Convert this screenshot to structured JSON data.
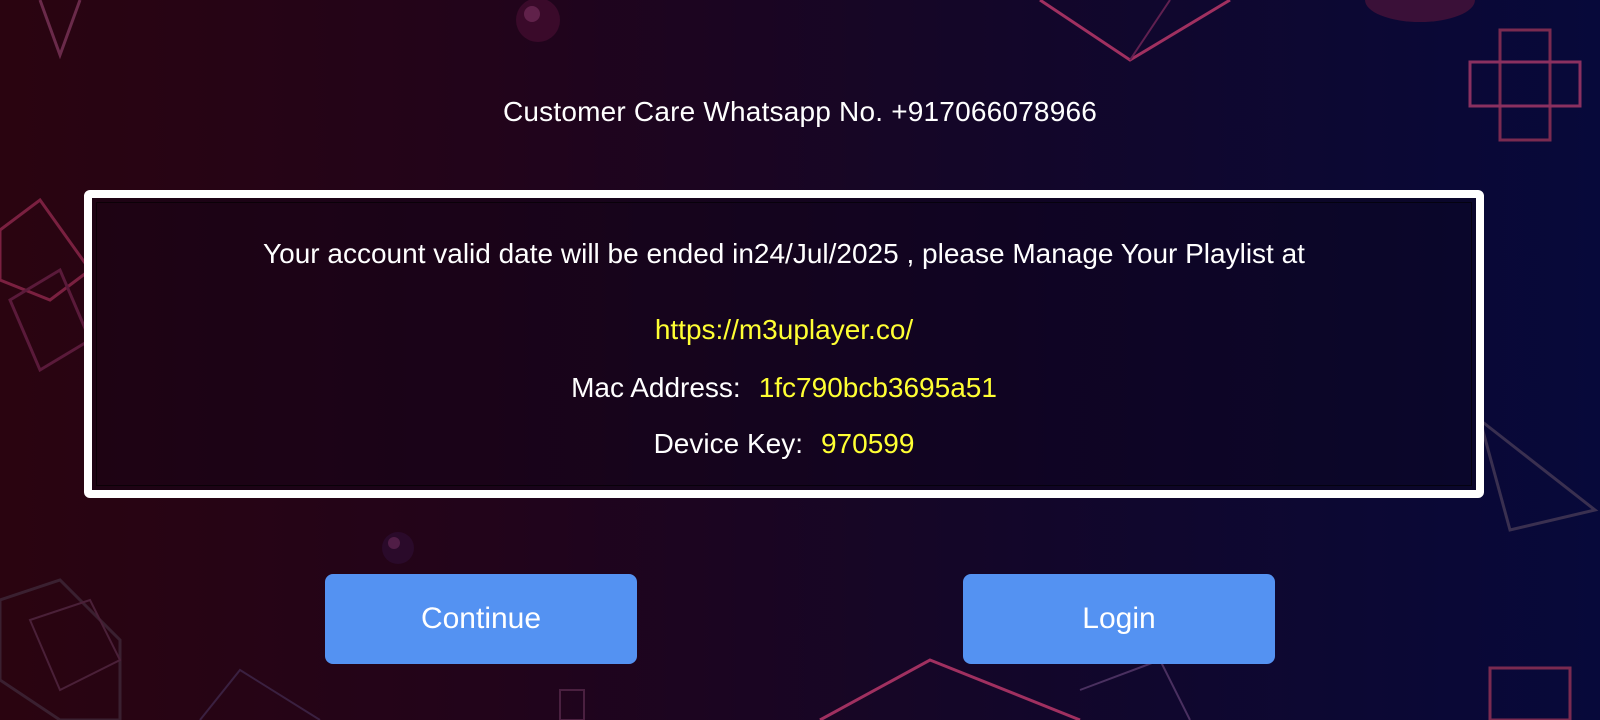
{
  "header": {
    "customer_care": "Customer Care Whatsapp No. +917066078966"
  },
  "account_box": {
    "expiry_message": "Your account valid date will be ended in24/Jul/2025 , please Manage Your Playlist at",
    "url": "https://m3uplayer.co/",
    "mac_label": "Mac Address:",
    "mac_value": "1fc790bcb3695a51",
    "device_key_label": "Device Key:",
    "device_key_value": "970599"
  },
  "buttons": {
    "continue_label": "Continue",
    "login_label": "Login"
  },
  "colors": {
    "accent_button": "#5492f2",
    "highlight_text": "#ffff33",
    "box_border": "#ffffff"
  }
}
